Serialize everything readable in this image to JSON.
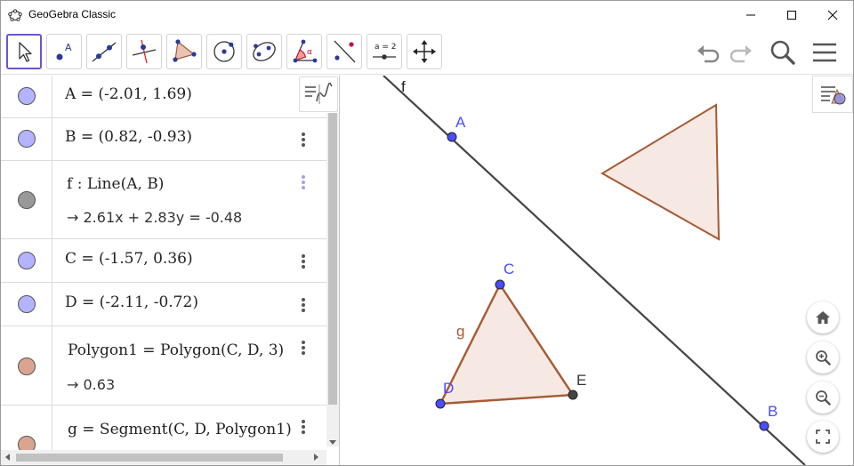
{
  "window": {
    "title": "GeoGebra Classic"
  },
  "toolbar": {
    "tools": [
      {
        "name": "move-tool",
        "icon": "arrow-pointer-icon"
      },
      {
        "name": "point-tool",
        "icon": "point-icon",
        "label": "A"
      },
      {
        "name": "line-tool",
        "icon": "line-through-two-points-icon"
      },
      {
        "name": "perpendicular-line-tool",
        "icon": "perpendicular-line-icon"
      },
      {
        "name": "polygon-tool",
        "icon": "polygon-icon"
      },
      {
        "name": "circle-tool",
        "icon": "circle-center-point-icon"
      },
      {
        "name": "ellipse-tool",
        "icon": "ellipse-icon"
      },
      {
        "name": "angle-tool",
        "icon": "angle-icon",
        "label": "α"
      },
      {
        "name": "reflect-tool",
        "icon": "reflect-about-line-icon"
      },
      {
        "name": "slider-tool",
        "icon": "slider-icon",
        "label": "a = 2"
      },
      {
        "name": "move-graphics-tool",
        "icon": "move-graphics-view-icon"
      }
    ],
    "right": [
      "undo-icon",
      "redo-icon",
      "search-icon",
      "menu-icon"
    ]
  },
  "algebra": {
    "rows": [
      {
        "expr": "A = (-2.01, 1.69)",
        "color": "#b3b3ff"
      },
      {
        "expr": "B = (0.82, -0.93)",
        "color": "#b3b3ff"
      },
      {
        "expr": "f : Line(A, B)",
        "output": "→ 2.61x + 2.83y = -0.48",
        "color": "#999999"
      },
      {
        "expr": "C = (-1.57, 0.36)",
        "color": "#b3b3ff"
      },
      {
        "expr": "D = (-2.11, -0.72)",
        "color": "#b3b3ff"
      },
      {
        "expr": "Polygon1 = Polygon(C, D, 3)",
        "output": "→ 0.63",
        "color": "#d9a590"
      },
      {
        "expr": "g = Segment(C, D, Polygon1)",
        "color": "#d9a590"
      }
    ]
  },
  "graphics": {
    "labels": {
      "f": "f",
      "A": "A",
      "B": "B",
      "C": "C",
      "D": "D",
      "E": "E",
      "g": "g"
    },
    "colors": {
      "point": "#4c4cff",
      "line": "#444444",
      "polygon_stroke": "#a65a33",
      "polygon_fill": "#f5e6e0"
    },
    "zoom_buttons": [
      "home-icon",
      "zoom-in-icon",
      "zoom-out-icon",
      "fullscreen-icon"
    ]
  }
}
